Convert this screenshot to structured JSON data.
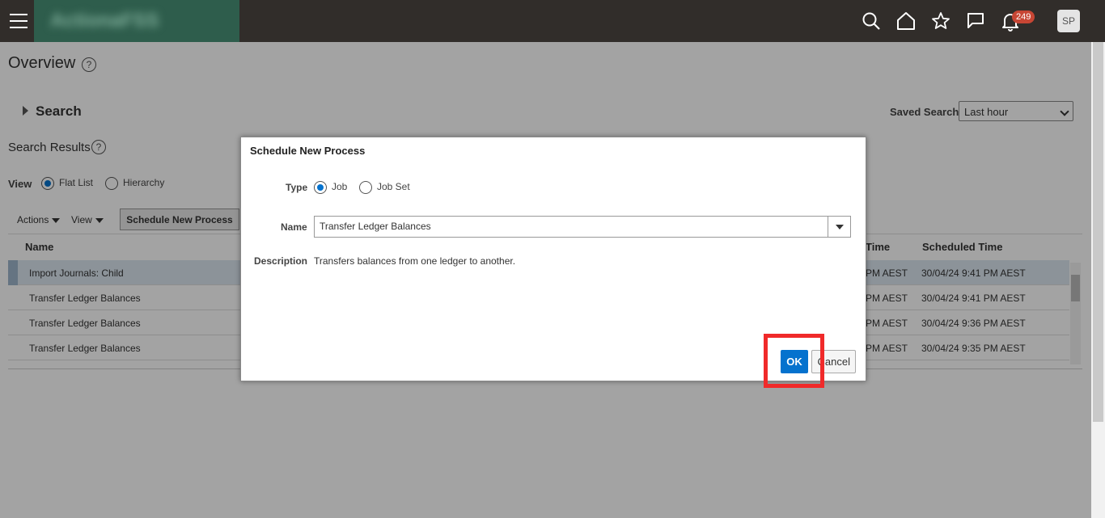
{
  "header": {
    "logo_text": "ActionaFSS",
    "notification_count": "249",
    "avatar_initials": "SP"
  },
  "page": {
    "title": "Overview",
    "help": "?",
    "search_label": "Search",
    "saved_search_label": "Saved Search",
    "saved_search_value": "Last hour",
    "results_title": "Search Results",
    "view_label": "View",
    "view_options": [
      "Flat List",
      "Hierarchy"
    ],
    "actions_label": "Actions",
    "view_menu_label": "View",
    "schedule_button": "Schedule New Process"
  },
  "table": {
    "columns": [
      "Name",
      "Time",
      "Scheduled Time"
    ],
    "rows": [
      {
        "name": "Import Journals: Child",
        "time": "PM AEST",
        "scheduled": "30/04/24 9:41 PM AEST"
      },
      {
        "name": "Transfer Ledger Balances",
        "time": "PM AEST",
        "scheduled": "30/04/24 9:41 PM AEST"
      },
      {
        "name": "Transfer Ledger Balances",
        "time": "PM AEST",
        "scheduled": "30/04/24 9:36 PM AEST"
      },
      {
        "name": "Transfer Ledger Balances",
        "time": "PM AEST",
        "scheduled": "30/04/24 9:35 PM AEST"
      }
    ]
  },
  "dialog": {
    "title": "Schedule New Process",
    "type_label": "Type",
    "type_options": [
      "Job",
      "Job Set"
    ],
    "name_label": "Name",
    "name_value": "Transfer Ledger Balances",
    "description_label": "Description",
    "description_value": "Transfers balances from one ledger to another.",
    "ok_label": "OK",
    "cancel_label": "Cancel"
  },
  "colors": {
    "topbar": "#312d2a",
    "accent": "#0572ce",
    "highlight": "#f02a2a"
  }
}
